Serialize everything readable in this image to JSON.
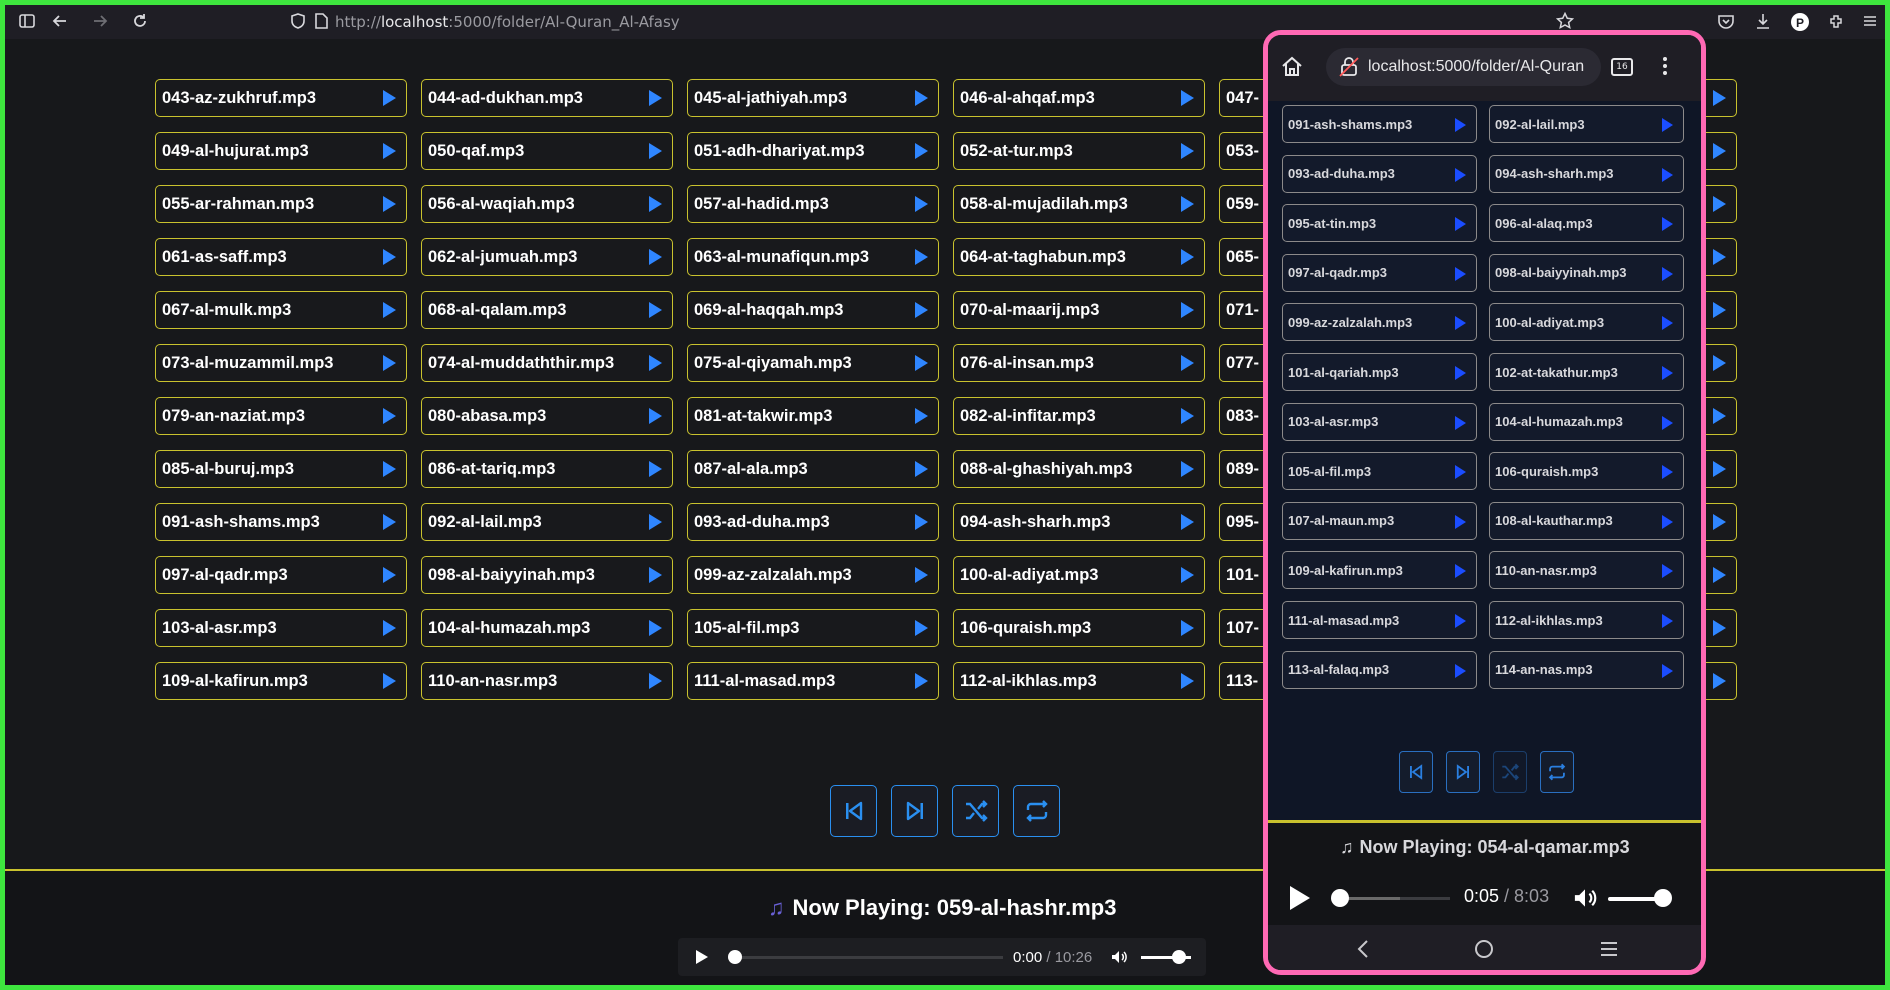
{
  "browser": {
    "url_prefix": "http://",
    "url_host": "localhost",
    "url_rest": ":5000/folder/Al-Quran_Al-Afasy",
    "icons": [
      "sidebar-icon",
      "back-icon",
      "forward-icon",
      "reload-icon",
      "shield-icon",
      "page-icon",
      "bookmark-star-icon",
      "pocket-icon",
      "download-icon",
      "profile-icon",
      "extensions-icon",
      "menu-icon"
    ]
  },
  "main": {
    "files": [
      [
        "043-az-zukhruf.mp3",
        "044-ad-dukhan.mp3",
        "045-al-jathiyah.mp3",
        "046-al-ahqaf.mp3",
        "047-"
      ],
      [
        "049-al-hujurat.mp3",
        "050-qaf.mp3",
        "051-adh-dhariyat.mp3",
        "052-at-tur.mp3",
        "053-"
      ],
      [
        "055-ar-rahman.mp3",
        "056-al-waqiah.mp3",
        "057-al-hadid.mp3",
        "058-al-mujadilah.mp3",
        "059-"
      ],
      [
        "061-as-saff.mp3",
        "062-al-jumuah.mp3",
        "063-al-munafiqun.mp3",
        "064-at-taghabun.mp3",
        "065-"
      ],
      [
        "067-al-mulk.mp3",
        "068-al-qalam.mp3",
        "069-al-haqqah.mp3",
        "070-al-maarij.mp3",
        "071-"
      ],
      [
        "073-al-muzammil.mp3",
        "074-al-muddaththir.mp3",
        "075-al-qiyamah.mp3",
        "076-al-insan.mp3",
        "077-"
      ],
      [
        "079-an-naziat.mp3",
        "080-abasa.mp3",
        "081-at-takwir.mp3",
        "082-al-infitar.mp3",
        "083-"
      ],
      [
        "085-al-buruj.mp3",
        "086-at-tariq.mp3",
        "087-al-ala.mp3",
        "088-al-ghashiyah.mp3",
        "089-"
      ],
      [
        "091-ash-shams.mp3",
        "092-al-lail.mp3",
        "093-ad-duha.mp3",
        "094-ash-sharh.mp3",
        "095-"
      ],
      [
        "097-al-qadr.mp3",
        "098-al-baiyyinah.mp3",
        "099-az-zalzalah.mp3",
        "100-al-adiyat.mp3",
        "101-"
      ],
      [
        "103-al-asr.mp3",
        "104-al-humazah.mp3",
        "105-al-fil.mp3",
        "106-quraish.mp3",
        "107-"
      ],
      [
        "109-al-kafirun.mp3",
        "110-an-nasr.mp3",
        "111-al-masad.mp3",
        "112-al-ikhlas.mp3",
        "113-"
      ]
    ],
    "now_playing": "Now Playing: 059-al-hashr.mp3",
    "time_current": "0:00",
    "time_total": " / 10:26",
    "progress_fraction": 0.0,
    "volume_fraction": 0.6,
    "controls": [
      "previous-icon",
      "next-icon",
      "shuffle-icon",
      "repeat-icon"
    ]
  },
  "phone": {
    "url": "localhost:5000/folder/Al-Quran",
    "tab_count": "16",
    "files": [
      [
        "091-ash-shams.mp3",
        "092-al-lail.mp3"
      ],
      [
        "093-ad-duha.mp3",
        "094-ash-sharh.mp3"
      ],
      [
        "095-at-tin.mp3",
        "096-al-alaq.mp3"
      ],
      [
        "097-al-qadr.mp3",
        "098-al-baiyyinah.mp3"
      ],
      [
        "099-az-zalzalah.mp3",
        "100-al-adiyat.mp3"
      ],
      [
        "101-al-qariah.mp3",
        "102-at-takathur.mp3"
      ],
      [
        "103-al-asr.mp3",
        "104-al-humazah.mp3"
      ],
      [
        "105-al-fil.mp3",
        "106-quraish.mp3"
      ],
      [
        "107-al-maun.mp3",
        "108-al-kauthar.mp3"
      ],
      [
        "109-al-kafirun.mp3",
        "110-an-nasr.mp3"
      ],
      [
        "111-al-masad.mp3",
        "112-al-ikhlas.mp3"
      ],
      [
        "113-al-falaq.mp3",
        "114-an-nas.mp3"
      ]
    ],
    "now_playing": "Now Playing: 054-al-qamar.mp3",
    "time_current": "0:05",
    "time_total": " / 8:03",
    "progress_fraction": 0.01,
    "volume_fraction": 0.85
  },
  "colors": {
    "accent_border": "#c9c22e",
    "play_blue": "#2f86ff",
    "phone_border": "#ff69b4",
    "window_border": "#3ee63e"
  }
}
